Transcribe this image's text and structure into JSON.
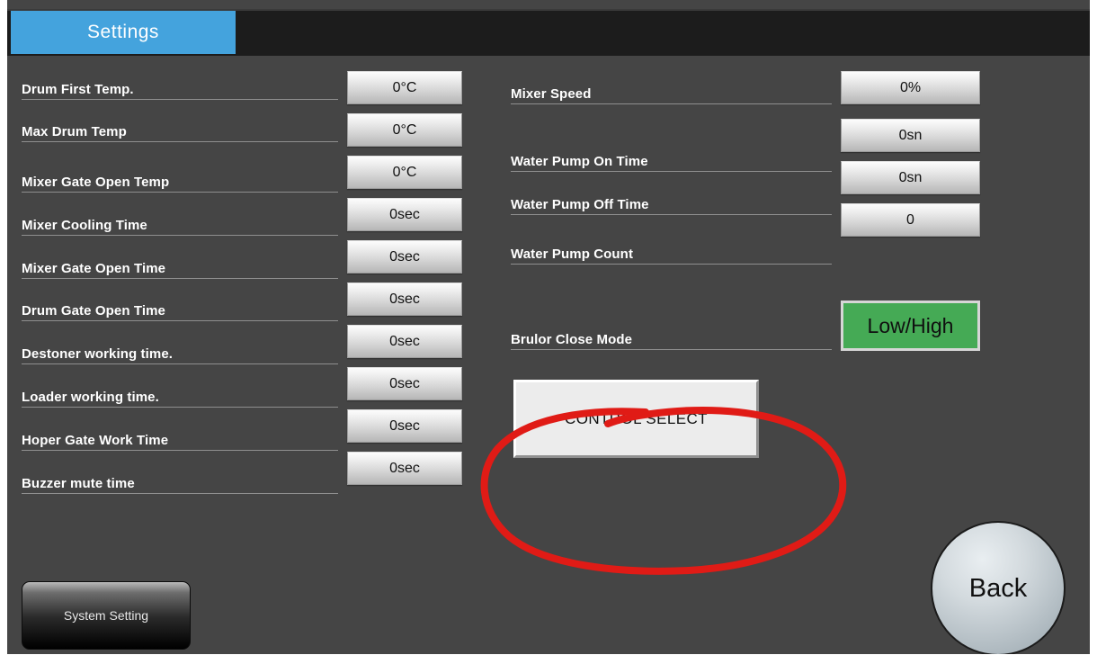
{
  "app": {
    "title": "Settings",
    "background_color": "#454545",
    "accent_color": "#44a3dd"
  },
  "header": {
    "tab_label": "Settings"
  },
  "left_column": {
    "rows": [
      {
        "label": "Drum First Temp.",
        "value": "0°C"
      },
      {
        "label": "Max Drum Temp",
        "value": "0°C"
      },
      {
        "label": "Mixer Gate Open Temp",
        "value": "0°C"
      },
      {
        "label": "Mixer Cooling Time",
        "value": "0sec"
      },
      {
        "label": "Mixer Gate Open Time",
        "value": "0sec"
      },
      {
        "label": "Drum Gate Open Time",
        "value": "0sec"
      },
      {
        "label": "Destoner working time.",
        "value": "0sec"
      },
      {
        "label": "Loader working time.",
        "value": "0sec"
      },
      {
        "label": "Hoper Gate Work Time",
        "value": "0sec"
      },
      {
        "label": "Buzzer mute time",
        "value": "0sec"
      }
    ],
    "system_setting_label": "System Setting"
  },
  "right_column": {
    "rows": [
      {
        "label": "Mixer Speed",
        "value": "0%"
      },
      {
        "label": "Water Pump On Time",
        "value": "0sn"
      },
      {
        "label": "Water Pump Off Time",
        "value": "0sn"
      },
      {
        "label": "Water Pump Count",
        "value": "0"
      }
    ],
    "brulor_label": "Brulor Close Mode",
    "lowhigh_label": "Low/High",
    "lowhigh_color": "#45aa55",
    "control_select_label": "CONTROL SELECT"
  },
  "footer": {
    "back_label": "Back"
  },
  "annotation": {
    "shape": "ellipse",
    "color": "#e01b16",
    "target": "CONTROL SELECT"
  }
}
